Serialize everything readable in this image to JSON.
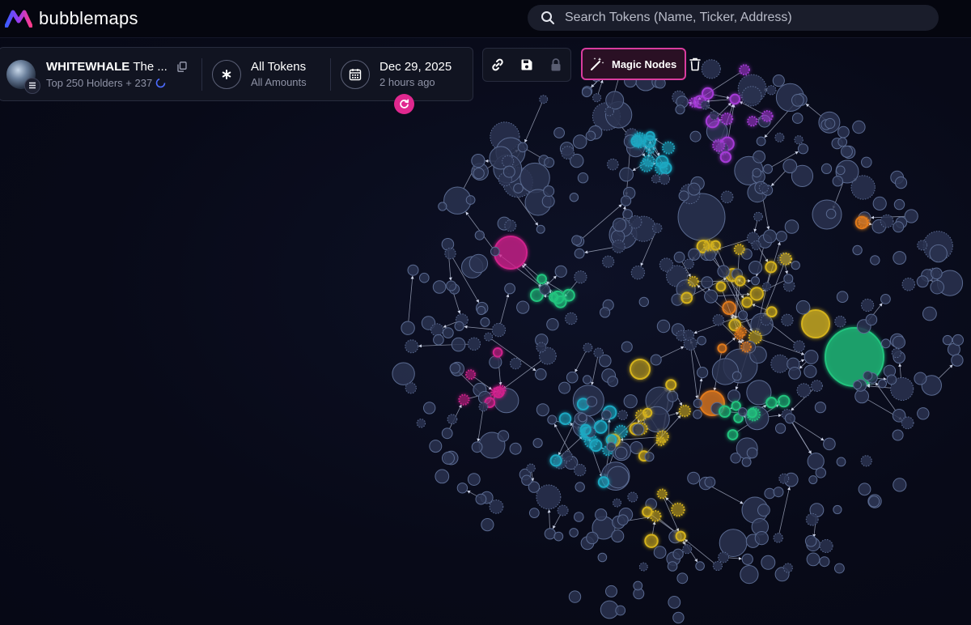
{
  "app": {
    "logo_text": "bubblemaps"
  },
  "search": {
    "placeholder": "Search Tokens (Name, Ticker, Address)"
  },
  "token": {
    "name": "WHITEWHALE",
    "name_suffix": "The ...",
    "holders_text": "Top 250 Holders + 237"
  },
  "filters": {
    "tokens_title": "All Tokens",
    "tokens_sub": "All Amounts",
    "date_title": "Dec 29, 2025",
    "date_sub": "2 hours ago"
  },
  "toolbar": {
    "magic_label": "Magic Nodes"
  },
  "icons": {
    "logo": "bubblemaps-logo-icon",
    "search": "search-icon",
    "copy": "copy-icon",
    "chain": "solana-icon",
    "loading": "loading-icon",
    "all_tokens": "asterisk-icon",
    "date": "calendar-icon",
    "refresh": "refresh-icon",
    "link": "link-icon",
    "save": "save-icon",
    "lock": "lock-icon",
    "magic": "magic-wand-icon",
    "trash": "trash-icon"
  },
  "colors": {
    "background": "#080a18",
    "accent_pink": "#e0288f",
    "node_default": "#2a3350",
    "node_stroke": "#5a6a90",
    "cluster_pink": "#d0228c",
    "cluster_purple": "#a53ad6",
    "cluster_cyan": "#1fa8c2",
    "cluster_yellow": "#d4b21f",
    "cluster_orange": "#e07a1e",
    "cluster_green": "#21c47e"
  }
}
